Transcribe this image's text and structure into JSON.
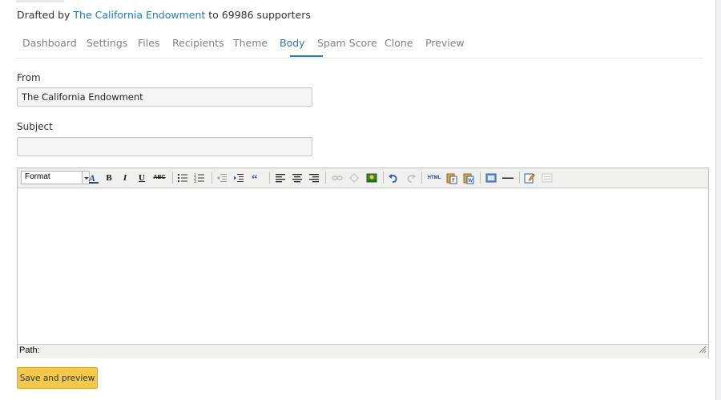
{
  "header": {
    "drafted_prefix": "Drafted by",
    "drafted_org": "The California Endowment",
    "drafted_suffix": "to 69986 supporters"
  },
  "tabs": [
    {
      "label": "Dashboard"
    },
    {
      "label": "Settings"
    },
    {
      "label": "Files"
    },
    {
      "label": "Recipients"
    },
    {
      "label": "Theme"
    },
    {
      "label": "Body",
      "active": true
    },
    {
      "label": "Spam Score"
    },
    {
      "label": "Clone"
    },
    {
      "label": "Preview"
    }
  ],
  "form": {
    "from_label": "From",
    "from_value": "The California Endowment",
    "subject_label": "Subject",
    "subject_value": ""
  },
  "editor": {
    "format_label": "Format",
    "toolbar_text": {
      "bold": "B",
      "italic": "I",
      "underline": "U",
      "strike": "ABC",
      "html": "HTML"
    },
    "toolbar_icons": [
      "font-color-icon",
      "bold-icon",
      "italic-icon",
      "underline-icon",
      "strikethrough-icon",
      "bullet-list-icon",
      "numbered-list-icon",
      "outdent-icon",
      "indent-icon",
      "blockquote-icon",
      "align-left-icon",
      "align-center-icon",
      "align-right-icon",
      "link-icon",
      "unlink-icon",
      "image-icon",
      "undo-icon",
      "redo-icon",
      "html-source-icon",
      "paste-text-icon",
      "paste-word-icon",
      "media-icon",
      "horizontal-rule-icon",
      "edit-icon",
      "cleanup-icon"
    ],
    "path_label": "Path:"
  },
  "actions": {
    "save_label": "Save and preview"
  },
  "colors": {
    "link": "#2a7ab8",
    "button": "#f2c94c"
  }
}
